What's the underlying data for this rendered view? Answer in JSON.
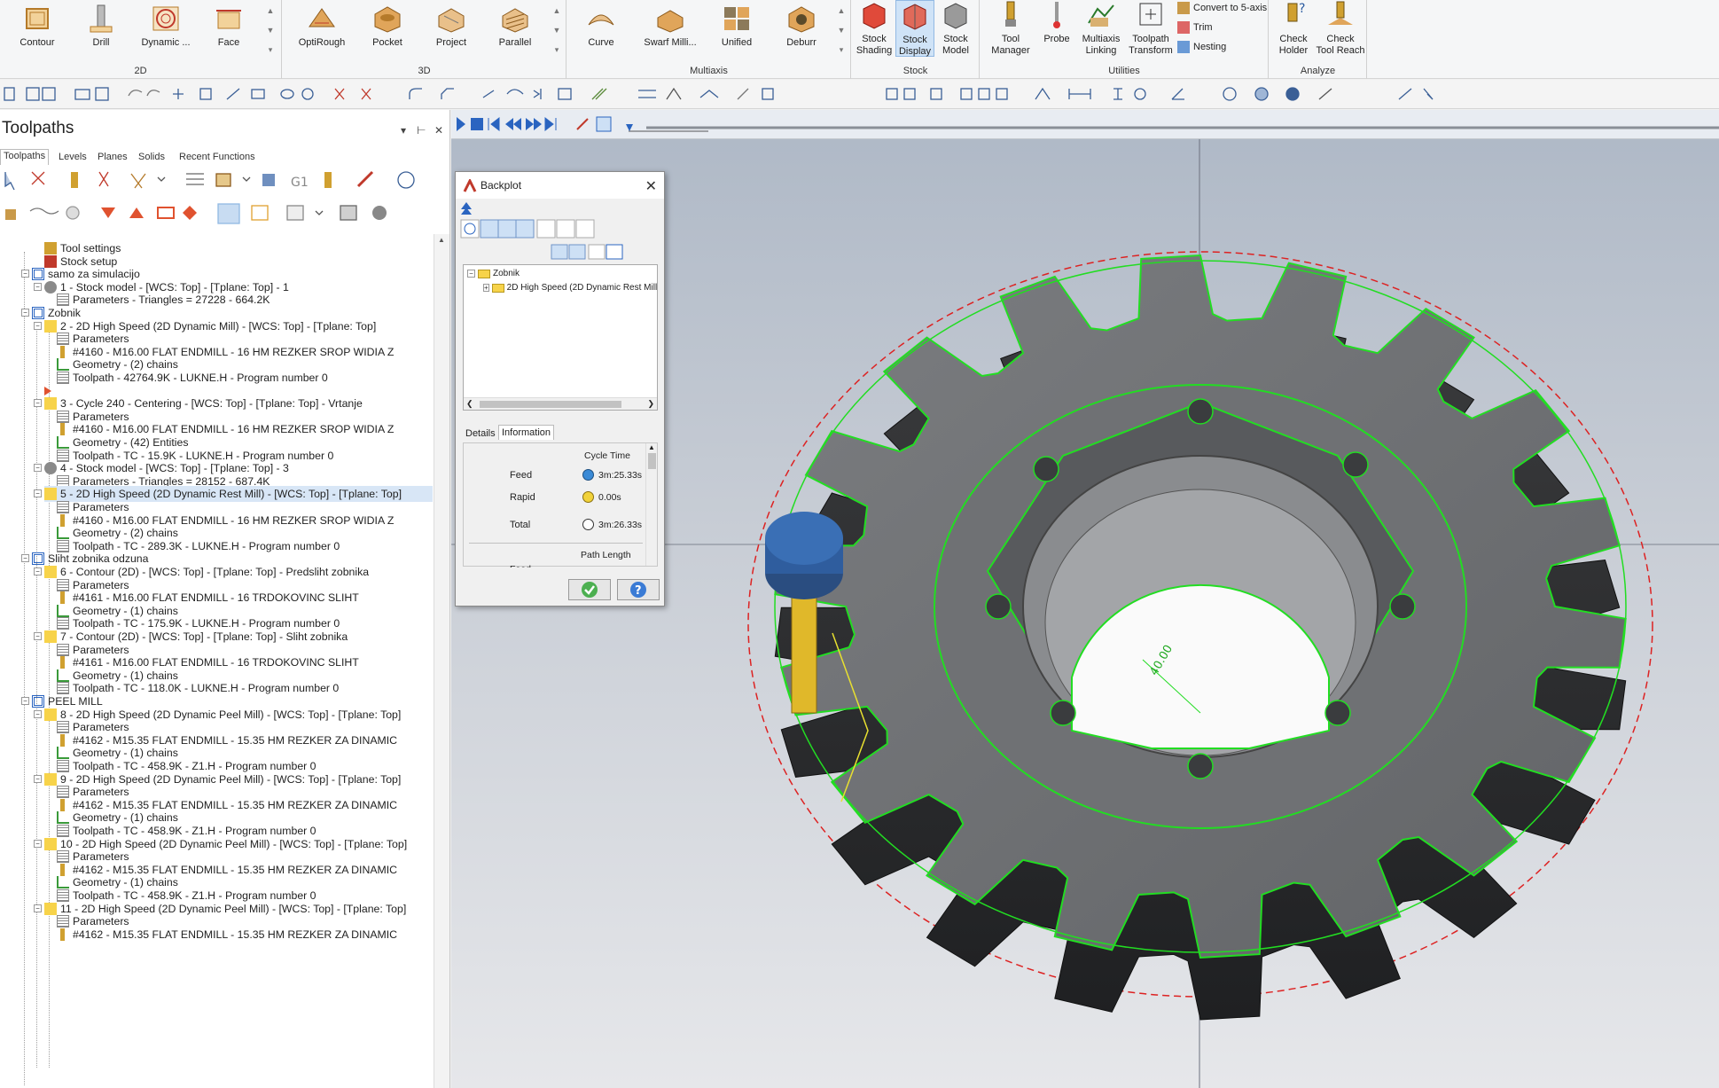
{
  "ribbon": {
    "groups": [
      {
        "name": "2D",
        "buttons": [
          "Contour",
          "Drill",
          "Dynamic ...",
          "Face"
        ]
      },
      {
        "name": "3D",
        "buttons": [
          "OptiRough",
          "Pocket",
          "Project",
          "Parallel"
        ]
      },
      {
        "name": "Multiaxis",
        "buttons": [
          "Curve",
          "Swarf Milli...",
          "Unified",
          "Deburr"
        ]
      },
      {
        "name": "Stock",
        "buttons": [
          "Stock\nShading",
          "Stock\nDisplay",
          "Stock\nModel"
        ]
      },
      {
        "name": "Utilities",
        "buttons": [
          "Tool\nManager",
          "Probe",
          "Multiaxis\nLinking",
          "Toolpath\nTransform"
        ],
        "small": [
          "Convert to 5-axis",
          "Trim",
          "Nesting"
        ]
      },
      {
        "name": "Analyze",
        "buttons": [
          "Check\nHolder",
          "Check\nTool Reach"
        ]
      }
    ]
  },
  "panel": {
    "title": "Toolpaths",
    "tabs": [
      "Toolpaths",
      "Levels",
      "Planes",
      "Solids",
      "Recent Functions"
    ]
  },
  "tree": [
    {
      "indent": 2,
      "icon": "tool-settings-icon",
      "text": "Tool settings"
    },
    {
      "indent": 2,
      "icon": "stock-setup-icon",
      "text": "Stock setup"
    },
    {
      "indent": 1,
      "icon": "machine-group-icon",
      "text": "samo za simulacijo"
    },
    {
      "indent": 2,
      "icon": "stock-model-icon",
      "text": "1 - Stock model - [WCS: Top] - [Tplane: Top] - 1"
    },
    {
      "indent": 3,
      "icon": "parameters-icon",
      "text": "Parameters - Triangles =  27228 - 664.2K"
    },
    {
      "indent": 1,
      "icon": "machine-group-icon",
      "text": "Zobnik"
    },
    {
      "indent": 2,
      "icon": "folder-icon",
      "text": "2 - 2D High Speed (2D Dynamic Mill) - [WCS: Top] - [Tplane: Top]"
    },
    {
      "indent": 3,
      "icon": "parameters-icon",
      "text": "Parameters"
    },
    {
      "indent": 3,
      "icon": "tool-icon",
      "text": "#4160 - M16.00 FLAT ENDMILL - 16 HM REZKER SROP WIDIA Z"
    },
    {
      "indent": 3,
      "icon": "geometry-icon",
      "text": "Geometry - (2) chains"
    },
    {
      "indent": 3,
      "icon": "toolpath-icon",
      "text": "Toolpath - 42764.9K - LUKNE.H - Program number 0"
    },
    {
      "indent": 2,
      "icon": "insert-arrow-icon",
      "text": ""
    },
    {
      "indent": 2,
      "icon": "folder-icon",
      "text": "3 - Cycle 240 - Centering - [WCS: Top] - [Tplane: Top] - Vrtanje"
    },
    {
      "indent": 3,
      "icon": "parameters-icon",
      "text": "Parameters"
    },
    {
      "indent": 3,
      "icon": "tool-icon",
      "text": "#4160 - M16.00 FLAT ENDMILL - 16 HM REZKER SROP WIDIA Z"
    },
    {
      "indent": 3,
      "icon": "geometry-icon",
      "text": "Geometry - (42) Entities"
    },
    {
      "indent": 3,
      "icon": "toolpath-icon",
      "text": "Toolpath - TC - 15.9K - LUKNE.H - Program number 0"
    },
    {
      "indent": 2,
      "icon": "stock-model-icon",
      "text": "4 - Stock model - [WCS: Top] - [Tplane: Top] - 3"
    },
    {
      "indent": 3,
      "icon": "parameters-icon",
      "text": "Parameters - Triangles =  28152 - 687.4K"
    },
    {
      "indent": 2,
      "icon": "folder-icon",
      "text": "5 - 2D High Speed (2D Dynamic Rest Mill) - [WCS: Top] - [Tplane: Top]",
      "highlight": true
    },
    {
      "indent": 3,
      "icon": "parameters-icon",
      "text": "Parameters"
    },
    {
      "indent": 3,
      "icon": "tool-icon",
      "text": "#4160 - M16.00 FLAT ENDMILL - 16 HM REZKER SROP WIDIA Z"
    },
    {
      "indent": 3,
      "icon": "geometry-icon",
      "text": "Geometry - (2) chains"
    },
    {
      "indent": 3,
      "icon": "toolpath-icon",
      "text": "Toolpath - TC - 289.3K - LUKNE.H - Program number 0"
    },
    {
      "indent": 1,
      "icon": "machine-group-icon",
      "text": "Sliht zobnika odzuna"
    },
    {
      "indent": 2,
      "icon": "folder-icon",
      "text": "6 - Contour (2D) - [WCS: Top] - [Tplane: Top] - Predsliht zobnika"
    },
    {
      "indent": 3,
      "icon": "parameters-icon",
      "text": "Parameters"
    },
    {
      "indent": 3,
      "icon": "tool-icon",
      "text": "#4161 - M16.00 FLAT ENDMILL - 16 TRDOKOVINC SLIHT"
    },
    {
      "indent": 3,
      "icon": "geometry-icon",
      "text": "Geometry - (1) chains"
    },
    {
      "indent": 3,
      "icon": "toolpath-icon",
      "text": "Toolpath - TC - 175.9K - LUKNE.H - Program number 0"
    },
    {
      "indent": 2,
      "icon": "folder-icon",
      "text": "7 - Contour (2D) - [WCS: Top] - [Tplane: Top] - Sliht zobnika"
    },
    {
      "indent": 3,
      "icon": "parameters-icon",
      "text": "Parameters"
    },
    {
      "indent": 3,
      "icon": "tool-icon",
      "text": "#4161 - M16.00 FLAT ENDMILL - 16 TRDOKOVINC SLIHT"
    },
    {
      "indent": 3,
      "icon": "geometry-icon",
      "text": "Geometry - (1) chains"
    },
    {
      "indent": 3,
      "icon": "toolpath-icon",
      "text": "Toolpath - TC - 118.0K - LUKNE.H - Program number 0"
    },
    {
      "indent": 1,
      "icon": "machine-group-icon",
      "text": "PEEL MILL"
    },
    {
      "indent": 2,
      "icon": "folder-icon",
      "text": "8 - 2D High Speed (2D Dynamic Peel Mill) - [WCS: Top] - [Tplane: Top]"
    },
    {
      "indent": 3,
      "icon": "parameters-icon",
      "text": "Parameters"
    },
    {
      "indent": 3,
      "icon": "tool-icon",
      "text": "#4162 - M15.35 FLAT ENDMILL - 15.35 HM REZKER ZA DINAMIC"
    },
    {
      "indent": 3,
      "icon": "geometry-icon",
      "text": "Geometry - (1) chains"
    },
    {
      "indent": 3,
      "icon": "toolpath-icon",
      "text": "Toolpath - TC - 458.9K - Z1.H - Program number 0"
    },
    {
      "indent": 2,
      "icon": "folder-icon",
      "text": "9 - 2D High Speed (2D Dynamic Peel Mill) - [WCS: Top] - [Tplane: Top]"
    },
    {
      "indent": 3,
      "icon": "parameters-icon",
      "text": "Parameters"
    },
    {
      "indent": 3,
      "icon": "tool-icon",
      "text": "#4162 - M15.35 FLAT ENDMILL - 15.35 HM REZKER ZA DINAMIC"
    },
    {
      "indent": 3,
      "icon": "geometry-icon",
      "text": "Geometry - (1) chains"
    },
    {
      "indent": 3,
      "icon": "toolpath-icon",
      "text": "Toolpath - TC - 458.9K - Z1.H - Program number 0"
    },
    {
      "indent": 2,
      "icon": "folder-icon",
      "text": "10 - 2D High Speed (2D Dynamic Peel Mill) - [WCS: Top] - [Tplane: Top]"
    },
    {
      "indent": 3,
      "icon": "parameters-icon",
      "text": "Parameters"
    },
    {
      "indent": 3,
      "icon": "tool-icon",
      "text": "#4162 - M15.35 FLAT ENDMILL - 15.35 HM REZKER ZA DINAMIC"
    },
    {
      "indent": 3,
      "icon": "geometry-icon",
      "text": "Geometry - (1) chains"
    },
    {
      "indent": 3,
      "icon": "toolpath-icon",
      "text": "Toolpath - TC - 458.9K - Z1.H - Program number 0"
    },
    {
      "indent": 2,
      "icon": "folder-icon",
      "text": "11 - 2D High Speed (2D Dynamic Peel Mill) - [WCS: Top] - [Tplane: Top]"
    },
    {
      "indent": 3,
      "icon": "parameters-icon",
      "text": "Parameters"
    },
    {
      "indent": 3,
      "icon": "tool-icon",
      "text": "#4162 - M15.35 FLAT ENDMILL - 15.35 HM REZKER ZA DINAMIC"
    }
  ],
  "backplot": {
    "title": "Backplot",
    "tree_root": "Zobnik",
    "tree_child": "2D High Speed (2D Dynamic Rest Mill)",
    "tabs": [
      "Details",
      "Information"
    ],
    "col_header": "Cycle Time",
    "rows": [
      {
        "label": "Feed",
        "value": "3m:25.33s"
      },
      {
        "label": "Rapid",
        "value": "0.00s"
      },
      {
        "label": "Total",
        "value": "3m:26.33s"
      }
    ],
    "path_header": "Path Length",
    "path_partial": "Feed"
  },
  "viewport": {
    "dimension": "40.00",
    "colors": {
      "toolpath": "#22dd22",
      "boundary": "#dd2222",
      "tool_holder": "#2f5d9e",
      "tool_shank": "#e0b82a"
    }
  }
}
